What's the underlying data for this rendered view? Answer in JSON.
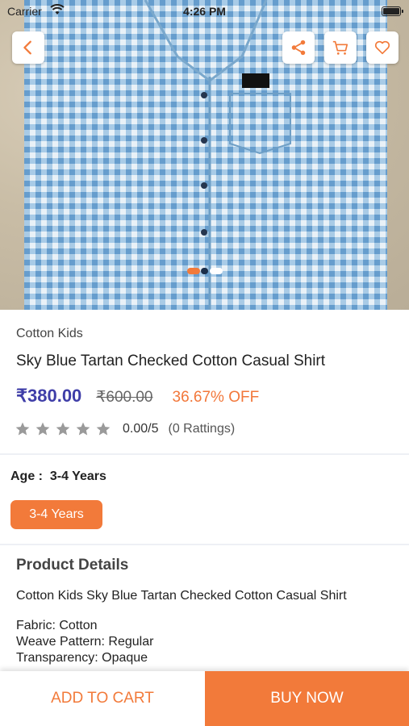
{
  "status_bar": {
    "carrier": "Carrier",
    "time": "4:26 PM"
  },
  "hero": {
    "buttons": {
      "back": "back-icon",
      "share": "share-icon",
      "cart": "cart-icon",
      "wishlist": "heart-icon"
    },
    "carousel": {
      "slides": 3,
      "active": 1
    }
  },
  "product": {
    "brand": "Cotton Kids",
    "title": "Sky Blue Tartan Checked Cotton Casual Shirt",
    "price": "₹380.00",
    "mrp": "₹600.00",
    "discount": "36.67% OFF",
    "rating": {
      "value": "0.00/5",
      "count": "(0 Rattings)",
      "stars_filled": 0,
      "stars_total": 5
    }
  },
  "age": {
    "label": "Age :",
    "selected": "3-4 Years",
    "options": [
      "3-4 Years"
    ]
  },
  "details": {
    "heading": "Product Details",
    "description": "Cotton Kids Sky Blue Tartan Checked Cotton Casual Shirt",
    "attributes": [
      "Fabric: Cotton",
      "Weave Pattern: Regular",
      "Transparency: Opaque"
    ]
  },
  "actions": {
    "add_to_cart": "ADD TO CART",
    "buy_now": "BUY NOW"
  },
  "colors": {
    "accent": "#f27a3a",
    "price": "#3f3ea8",
    "star": "#9a9a9a"
  }
}
